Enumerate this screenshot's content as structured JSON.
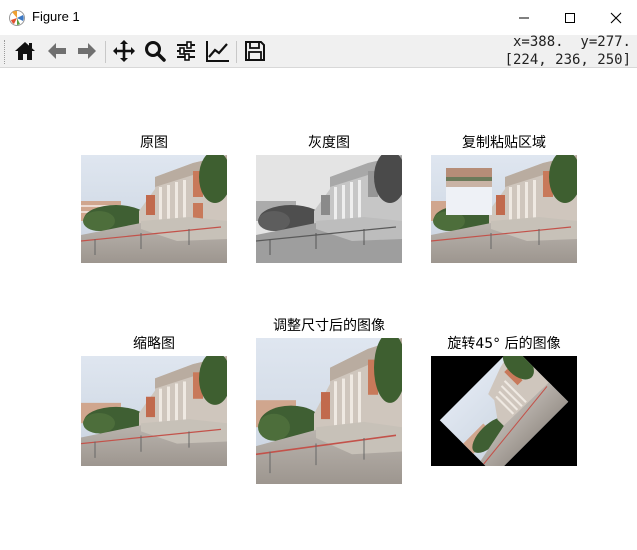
{
  "window": {
    "title": "Figure 1",
    "minimize_icon": "minimize-icon",
    "maximize_icon": "maximize-icon",
    "close_icon": "close-icon"
  },
  "toolbar": {
    "buttons": [
      "home-icon",
      "back-arrow-icon",
      "forward-arrow-icon",
      "pan-icon",
      "zoom-icon",
      "configure-subplots-icon",
      "edit-axes-icon",
      "save-icon"
    ],
    "coord_line1": "x=388.  y=277.",
    "coord_line2": "[224, 236, 250]"
  },
  "figure": {
    "subplots": [
      {
        "title": "原图",
        "variant": "original"
      },
      {
        "title": "灰度图",
        "variant": "gray"
      },
      {
        "title": "复制粘贴区域",
        "variant": "copy-paste"
      },
      {
        "title": "缩略图",
        "variant": "thumbnail"
      },
      {
        "title": "调整尺寸后的图像",
        "variant": "resized"
      },
      {
        "title": "旋转45° 后的图像",
        "variant": "rotated-45"
      }
    ]
  }
}
